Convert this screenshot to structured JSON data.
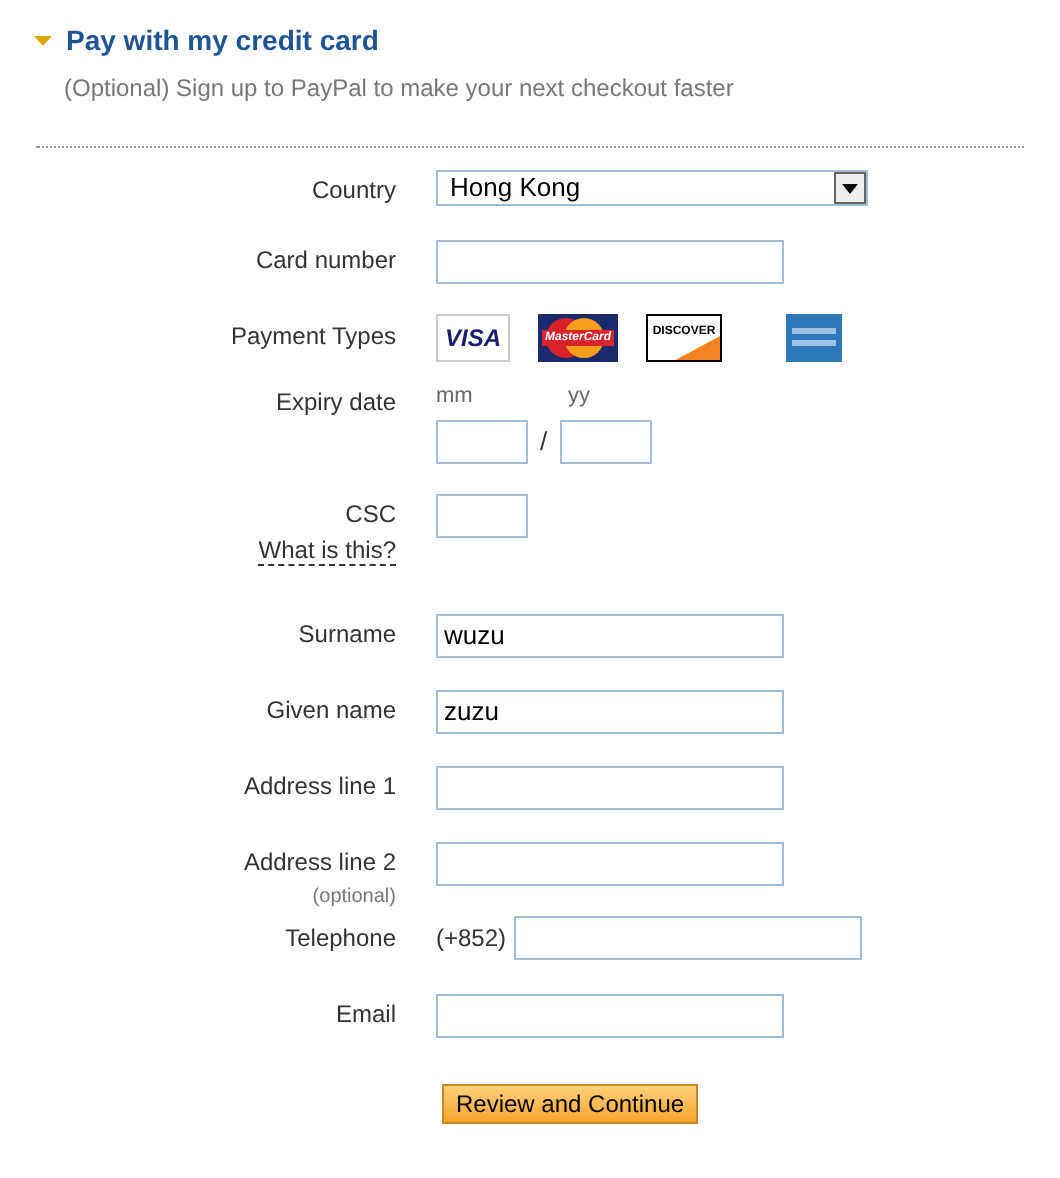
{
  "section": {
    "title": "Pay with my credit card",
    "expanded": true,
    "subtitle": "(Optional) Sign up to PayPal to make your next checkout faster"
  },
  "rows": [
    {
      "kind": "select",
      "label": "Country",
      "value": "Hong Kong"
    },
    {
      "kind": "text",
      "label": "Card number"
    },
    {
      "kind": "cards",
      "label": "Payment Types",
      "cards": [
        {
          "kind": "visa",
          "text": "VISA"
        },
        {
          "kind": "mastercard",
          "text": "MasterCard"
        },
        {
          "kind": "discover",
          "text": "DISCOVER"
        },
        {
          "kind": "amex"
        }
      ]
    },
    {
      "kind": "expiry",
      "label": "Expiry date",
      "month_hint": "mm",
      "year_hint": "yy",
      "separator": "/"
    },
    {
      "kind": "csc",
      "label": "CSC",
      "help_link": "What is this?"
    },
    {
      "kind": "text",
      "label": "Surname",
      "value": "wuzu"
    },
    {
      "kind": "text",
      "label": "Given name",
      "value": "zuzu"
    },
    {
      "kind": "text",
      "label": "Address line 1"
    },
    {
      "kind": "text",
      "label": "Address line 2",
      "note": "(optional)"
    },
    {
      "kind": "phone",
      "label": "Telephone",
      "prefix": "(+852)"
    },
    {
      "kind": "text",
      "label": "Email"
    }
  ],
  "submit": "Review and Continue"
}
